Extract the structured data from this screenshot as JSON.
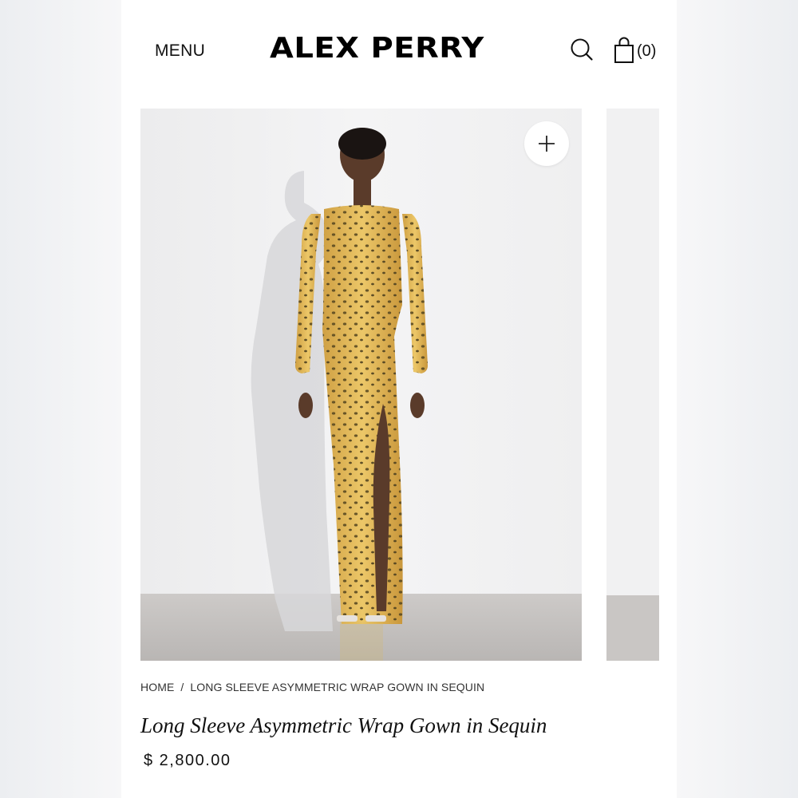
{
  "header": {
    "menu_label": "MENU",
    "logo_text": "ALEX PERRY",
    "search_icon": "search-icon",
    "cart_icon": "shopping-bag-icon",
    "cart_count": "(0)"
  },
  "gallery": {
    "main_image": "model in long-sleeve leopard-print sequin wrap gown",
    "zoom_icon": "plus-icon"
  },
  "breadcrumb": {
    "home": "HOME",
    "separator": "/",
    "current": "LONG SLEEVE ASYMMETRIC WRAP GOWN IN SEQUIN"
  },
  "product": {
    "title": "Long Sleeve Asymmetric Wrap Gown in Sequin",
    "price": "$ 2,800.00"
  },
  "colors": {
    "background": "#ffffff",
    "text": "#111111",
    "gown": "#e2b95a"
  }
}
